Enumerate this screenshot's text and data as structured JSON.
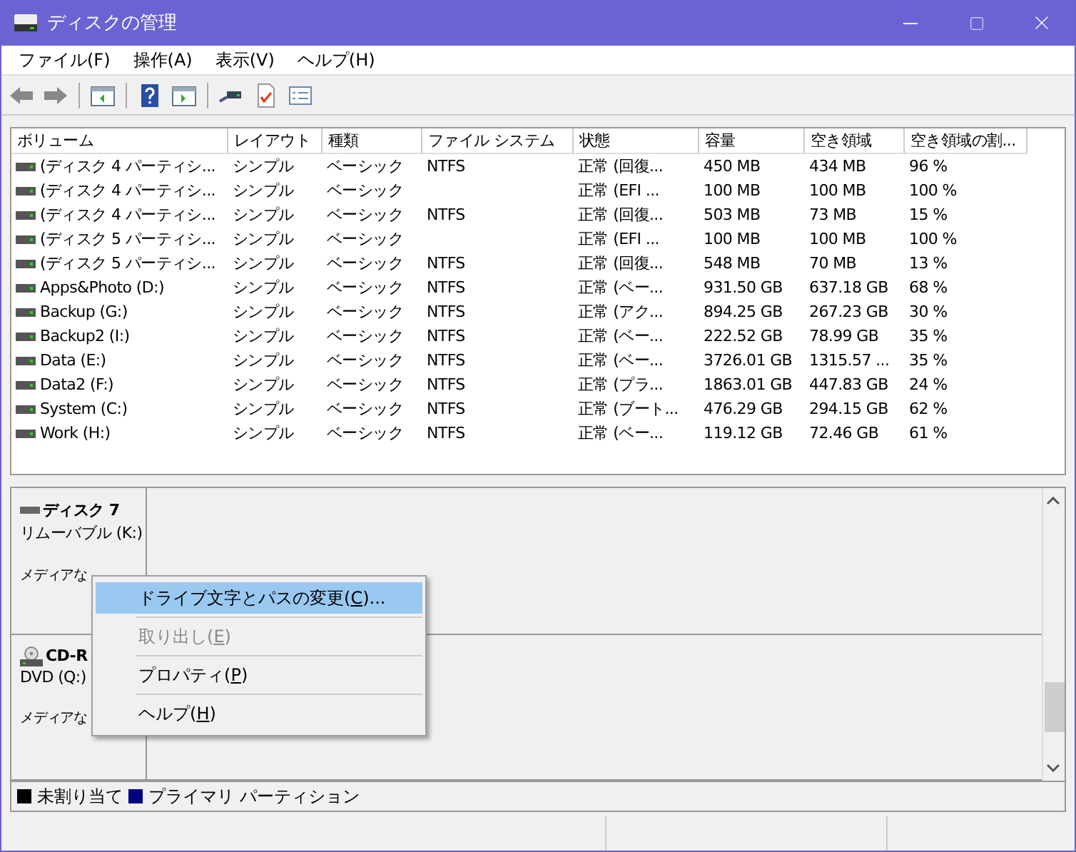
{
  "window": {
    "title": "ディスクの管理"
  },
  "menu_bar": [
    "ファイル(F)",
    "操作(A)",
    "表示(V)",
    "ヘルプ(H)"
  ],
  "table": {
    "columns": [
      "ボリューム",
      "レイアウト",
      "種類",
      "ファイル システム",
      "状態",
      "容量",
      "空き領域",
      "空き領域の割..."
    ],
    "rows": [
      [
        "(ディスク 4 パーティシ...",
        "シンプル",
        "ベーシック",
        "NTFS",
        "正常 (回復...",
        "450 MB",
        "434 MB",
        "96 %"
      ],
      [
        "(ディスク 4 パーティシ...",
        "シンプル",
        "ベーシック",
        "",
        "正常 (EFI ...",
        "100 MB",
        "100 MB",
        "100 %"
      ],
      [
        "(ディスク 4 パーティシ...",
        "シンプル",
        "ベーシック",
        "NTFS",
        "正常 (回復...",
        "503 MB",
        "73 MB",
        "15 %"
      ],
      [
        "(ディスク 5 パーティシ...",
        "シンプル",
        "ベーシック",
        "",
        "正常 (EFI ...",
        "100 MB",
        "100 MB",
        "100 %"
      ],
      [
        "(ディスク 5 パーティシ...",
        "シンプル",
        "ベーシック",
        "NTFS",
        "正常 (回復...",
        "548 MB",
        "70 MB",
        "13 %"
      ],
      [
        "Apps&Photo (D:)",
        "シンプル",
        "ベーシック",
        "NTFS",
        "正常 (ベー...",
        "931.50 GB",
        "637.18 GB",
        "68 %"
      ],
      [
        "Backup (G:)",
        "シンプル",
        "ベーシック",
        "NTFS",
        "正常 (アク...",
        "894.25 GB",
        "267.23 GB",
        "30 %"
      ],
      [
        "Backup2 (I:)",
        "シンプル",
        "ベーシック",
        "NTFS",
        "正常 (ベー...",
        "222.52 GB",
        "78.99 GB",
        "35 %"
      ],
      [
        "Data (E:)",
        "シンプル",
        "ベーシック",
        "NTFS",
        "正常 (ベー...",
        "3726.01 GB",
        "1315.57 ...",
        "35 %"
      ],
      [
        "Data2 (F:)",
        "シンプル",
        "ベーシック",
        "NTFS",
        "正常 (プラ...",
        "1863.01 GB",
        "447.83 GB",
        "24 %"
      ],
      [
        "System (C:)",
        "シンプル",
        "ベーシック",
        "NTFS",
        "正常 (ブート...",
        "476.29 GB",
        "294.15 GB",
        "62 %"
      ],
      [
        "Work (H:)",
        "シンプル",
        "ベーシック",
        "NTFS",
        "正常 (ベー...",
        "119.12 GB",
        "72.46 GB",
        "61 %"
      ]
    ]
  },
  "disks": [
    {
      "kind": "removable",
      "name": "ディスク 7",
      "type": "リムーバブル (K:)",
      "status": "メディアな"
    },
    {
      "kind": "optical",
      "name": "CD-R",
      "type": "DVD (Q:)",
      "status": "メディアな"
    }
  ],
  "legend": [
    {
      "label": "未割り当て",
      "color": "#000000"
    },
    {
      "label": "プライマリ パーティション",
      "color": "#000080"
    }
  ],
  "context_menu": [
    {
      "text": "ドライブ文字とパスの変更(",
      "access_key": "C",
      "tail": ")...",
      "selected": true,
      "disabled": false
    },
    {
      "text": "取り出し(",
      "access_key": "E",
      "tail": ")",
      "selected": false,
      "disabled": true
    },
    {
      "text": "プロパティ(",
      "access_key": "P",
      "tail": ")",
      "selected": false,
      "disabled": false
    },
    {
      "text": "ヘルプ(",
      "access_key": "H",
      "tail": ")",
      "selected": false,
      "disabled": false
    }
  ]
}
